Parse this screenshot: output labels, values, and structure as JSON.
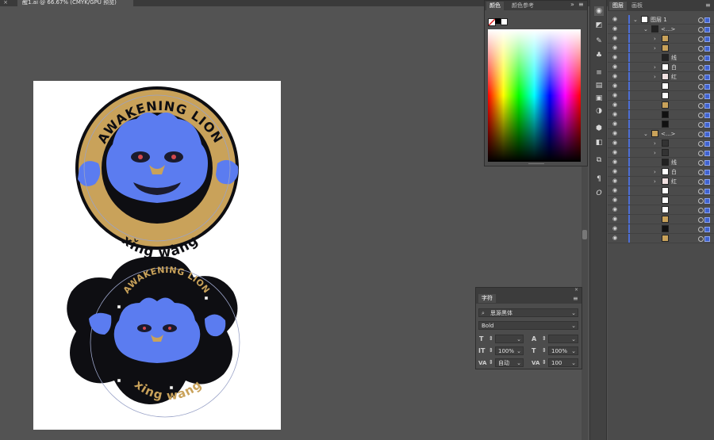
{
  "document": {
    "tab_title": "醒1.ai @ 66.67% (CMYK/GPU 预览)",
    "close_glyph": "×"
  },
  "artwork": {
    "badge1": {
      "top_text": "AWAKENING LION",
      "bottom_text": "xǐng wàng"
    },
    "badge2": {
      "top_text": "AWAKENING LION",
      "bottom_text": "xing wang"
    }
  },
  "color_panel": {
    "tabs": [
      "颜色",
      "颜色参考"
    ],
    "menu_glyph": "≡",
    "collapse_glyph": "»"
  },
  "character_panel": {
    "title": "字符",
    "font_family": "思源黑体",
    "font_style": "Bold",
    "size_value": "",
    "leading_value": "",
    "vscale_value": "100%",
    "hscale_value": "100%",
    "kerning_value": "自动",
    "tracking_value": "100",
    "labels": {
      "size": "T",
      "leading": "A",
      "vscale": "IT",
      "hscale": "T",
      "kerning": "VA",
      "tracking": "VA"
    }
  },
  "layers_panel": {
    "tabs": [
      "图层",
      "画板"
    ],
    "menu_glyph": "≡",
    "layer_title": "图层 1",
    "rows": [
      {
        "indent": 0,
        "chev": "⌄",
        "name": "图层 1",
        "thumb": "#ffffff"
      },
      {
        "indent": 1,
        "chev": "⌄",
        "name": "<...>",
        "thumb": "#222222"
      },
      {
        "indent": 2,
        "chev": "›",
        "name": "",
        "thumb": "#c9a25a"
      },
      {
        "indent": 2,
        "chev": "›",
        "name": "",
        "thumb": "#c9a25a"
      },
      {
        "indent": 2,
        "chev": "",
        "name": "线",
        "thumb": "#222222"
      },
      {
        "indent": 2,
        "chev": "›",
        "name": "白",
        "thumb": "#ffffff"
      },
      {
        "indent": 2,
        "chev": "›",
        "name": "红",
        "thumb": "#f0e0e0"
      },
      {
        "indent": 2,
        "chev": "",
        "name": "",
        "thumb": "#ffffff"
      },
      {
        "indent": 2,
        "chev": "",
        "name": "",
        "thumb": "#ffffff"
      },
      {
        "indent": 2,
        "chev": "",
        "name": "",
        "thumb": "#c9a25a"
      },
      {
        "indent": 2,
        "chev": "",
        "name": "",
        "thumb": "#111111"
      },
      {
        "indent": 2,
        "chev": "",
        "name": "",
        "thumb": "#111111"
      },
      {
        "indent": 1,
        "chev": "⌄",
        "name": "<...>",
        "thumb": "#c9a25a"
      },
      {
        "indent": 2,
        "chev": "›",
        "name": "",
        "thumb": "#333333"
      },
      {
        "indent": 2,
        "chev": "›",
        "name": "",
        "thumb": "#333333"
      },
      {
        "indent": 2,
        "chev": "",
        "name": "线",
        "thumb": "#222222"
      },
      {
        "indent": 2,
        "chev": "›",
        "name": "白",
        "thumb": "#ffffff"
      },
      {
        "indent": 2,
        "chev": "›",
        "name": "红",
        "thumb": "#f0e0e0"
      },
      {
        "indent": 2,
        "chev": "",
        "name": "",
        "thumb": "#ffffff"
      },
      {
        "indent": 2,
        "chev": "",
        "name": "",
        "thumb": "#ffffff"
      },
      {
        "indent": 2,
        "chev": "",
        "name": "",
        "thumb": "#ffffff"
      },
      {
        "indent": 2,
        "chev": "",
        "name": "",
        "thumb": "#c9a25a"
      },
      {
        "indent": 2,
        "chev": "",
        "name": "",
        "thumb": "#111111"
      },
      {
        "indent": 2,
        "chev": "",
        "name": "",
        "thumb": "#c9a25a"
      }
    ]
  },
  "colors": {
    "gold": "#c9a25a",
    "blue": "#5b7cf0",
    "black": "#0e0e12",
    "accent": "#4c6ed6"
  }
}
